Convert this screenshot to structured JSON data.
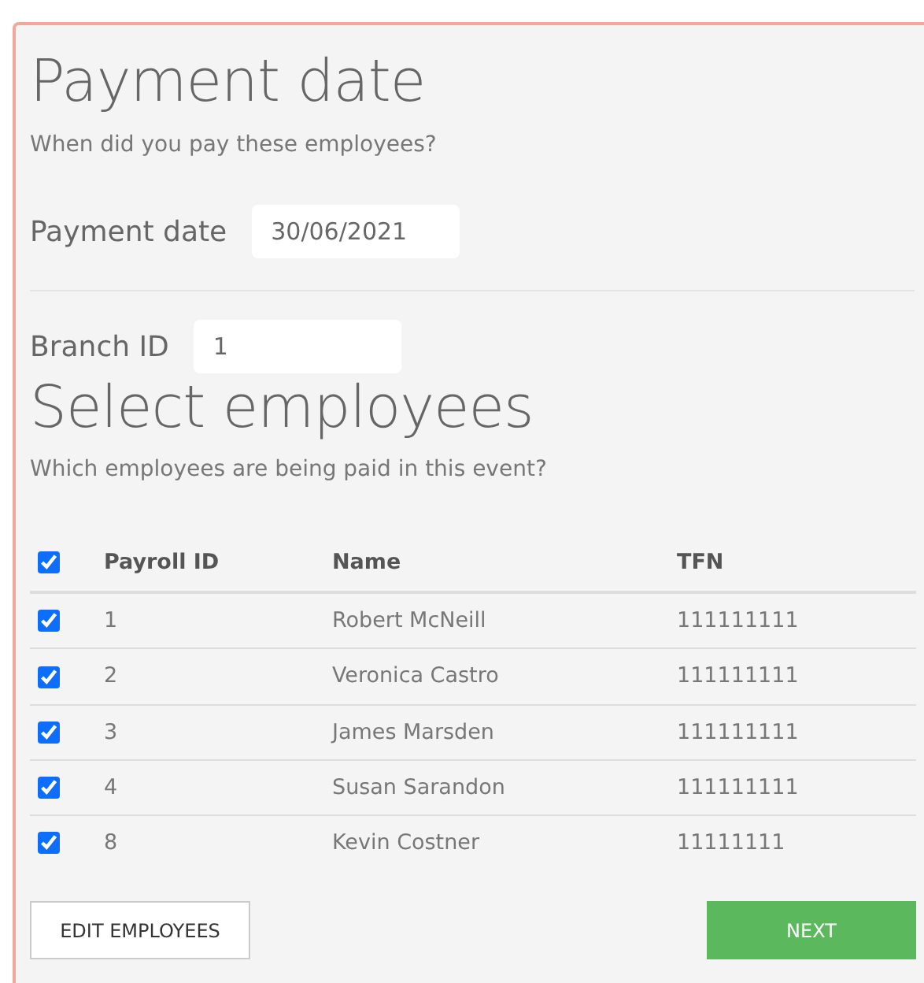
{
  "payment_section": {
    "title": "Payment date",
    "subtitle": "When did you pay these employees?",
    "date_label": "Payment date",
    "date_value": "30/06/2021"
  },
  "branch": {
    "label": "Branch ID",
    "value": "1"
  },
  "employees_section": {
    "title": "Select employees",
    "subtitle": "Which employees are being paid in this event?"
  },
  "table": {
    "select_all_checked": true,
    "columns": [
      "Payroll ID",
      "Name",
      "TFN"
    ],
    "rows": [
      {
        "checked": true,
        "payroll_id": "1",
        "name": "Robert McNeill",
        "tfn": "111111111"
      },
      {
        "checked": true,
        "payroll_id": "2",
        "name": "Veronica Castro",
        "tfn": "111111111"
      },
      {
        "checked": true,
        "payroll_id": "3",
        "name": "James Marsden",
        "tfn": "111111111"
      },
      {
        "checked": true,
        "payroll_id": "4",
        "name": "Susan Sarandon",
        "tfn": "111111111"
      },
      {
        "checked": true,
        "payroll_id": "8",
        "name": "Kevin Costner",
        "tfn": "11111111"
      }
    ]
  },
  "buttons": {
    "edit": "EDIT EMPLOYEES",
    "next": "NEXT"
  }
}
